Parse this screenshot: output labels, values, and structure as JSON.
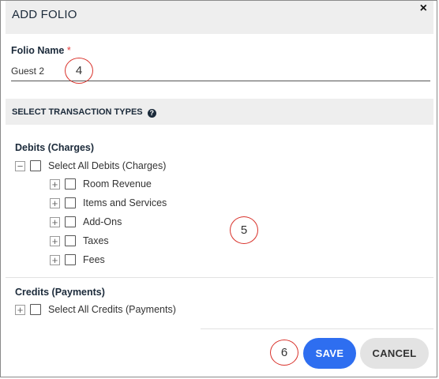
{
  "dialog": {
    "title": "ADD FOLIO",
    "close_glyph": "×"
  },
  "folio": {
    "label": "Folio Name",
    "required_mark": "*",
    "value": "Guest 2"
  },
  "transaction_types": {
    "title": "SELECT TRANSACTION TYPES",
    "help_glyph": "?"
  },
  "debits": {
    "title": "Debits (Charges)",
    "select_all_label": "Select All Debits (Charges)",
    "select_all_toggle": "−",
    "items": [
      {
        "label": "Room Revenue",
        "toggle": "+",
        "checked": false
      },
      {
        "label": "Items and Services",
        "toggle": "+",
        "checked": false
      },
      {
        "label": "Add-Ons",
        "toggle": "+",
        "checked": false
      },
      {
        "label": "Taxes",
        "toggle": "+",
        "checked": false
      },
      {
        "label": "Fees",
        "toggle": "+",
        "checked": false
      }
    ]
  },
  "credits": {
    "title": "Credits (Payments)",
    "select_all_label": "Select All Credits (Payments)",
    "select_all_toggle": "+"
  },
  "callouts": {
    "name_field": "4",
    "transaction_list": "5",
    "save_button": "6"
  },
  "footer": {
    "save_label": "SAVE",
    "cancel_label": "CANCEL"
  },
  "colors": {
    "primary": "#2e6ef0",
    "callout_ring": "#d9322b",
    "required": "#e53b3b"
  }
}
